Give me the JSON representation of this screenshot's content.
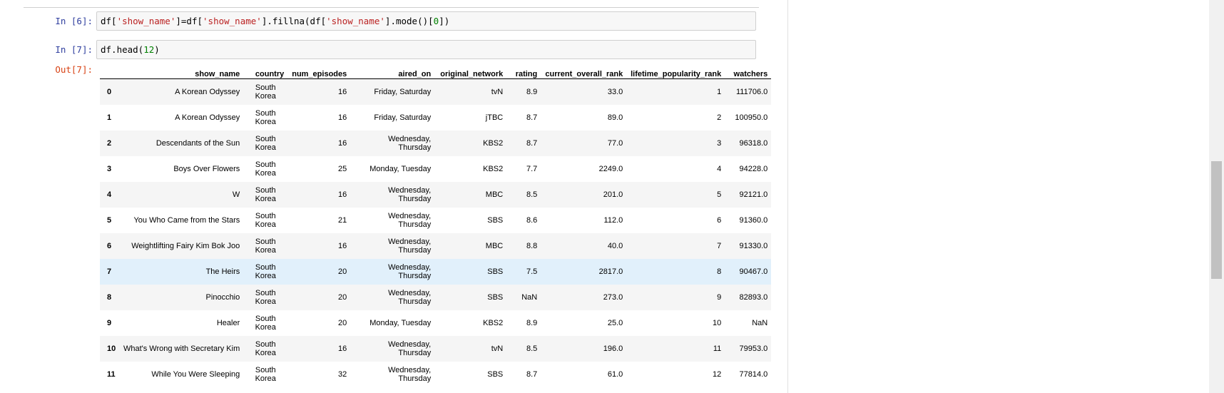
{
  "cells": [
    {
      "prompt": "In [6]:",
      "code": [
        {
          "t": "df[",
          "c": ""
        },
        {
          "t": "'show_name'",
          "c": "str"
        },
        {
          "t": "]=df[",
          "c": ""
        },
        {
          "t": "'show_name'",
          "c": "str"
        },
        {
          "t": "].fillna(df[",
          "c": ""
        },
        {
          "t": "'show_name'",
          "c": "str"
        },
        {
          "t": "].mode()[",
          "c": ""
        },
        {
          "t": "0",
          "c": "num"
        },
        {
          "t": "])",
          "c": ""
        }
      ]
    },
    {
      "prompt": "In [7]:",
      "code": [
        {
          "t": "df.head(",
          "c": ""
        },
        {
          "t": "12",
          "c": "num"
        },
        {
          "t": ")",
          "c": ""
        }
      ]
    }
  ],
  "output": {
    "prompt": "Out[7]:",
    "columns": [
      "",
      "show_name",
      "country",
      "num_episodes",
      "aired_on",
      "original_network",
      "rating",
      "current_overall_rank",
      "lifetime_popularity_rank",
      "watchers"
    ],
    "rows": [
      [
        "0",
        "A Korean Odyssey",
        "South Korea",
        "16",
        "Friday, Saturday",
        "tvN",
        "8.9",
        "33.0",
        "1",
        "111706.0"
      ],
      [
        "1",
        "A Korean Odyssey",
        "South Korea",
        "16",
        "Friday, Saturday",
        "jTBC",
        "8.7",
        "89.0",
        "2",
        "100950.0"
      ],
      [
        "2",
        "Descendants of the Sun",
        "South Korea",
        "16",
        "Wednesday, Thursday",
        "KBS2",
        "8.7",
        "77.0",
        "3",
        "96318.0"
      ],
      [
        "3",
        "Boys Over Flowers",
        "South Korea",
        "25",
        "Monday, Tuesday",
        "KBS2",
        "7.7",
        "2249.0",
        "4",
        "94228.0"
      ],
      [
        "4",
        "W",
        "South Korea",
        "16",
        "Wednesday, Thursday",
        "MBC",
        "8.5",
        "201.0",
        "5",
        "92121.0"
      ],
      [
        "5",
        "You Who Came from the Stars",
        "South Korea",
        "21",
        "Wednesday, Thursday",
        "SBS",
        "8.6",
        "112.0",
        "6",
        "91360.0"
      ],
      [
        "6",
        "Weightlifting Fairy Kim Bok Joo",
        "South Korea",
        "16",
        "Wednesday, Thursday",
        "MBC",
        "8.8",
        "40.0",
        "7",
        "91330.0"
      ],
      [
        "7",
        "The Heirs",
        "South Korea",
        "20",
        "Wednesday, Thursday",
        "SBS",
        "7.5",
        "2817.0",
        "8",
        "90467.0"
      ],
      [
        "8",
        "Pinocchio",
        "South Korea",
        "20",
        "Wednesday, Thursday",
        "SBS",
        "NaN",
        "273.0",
        "9",
        "82893.0"
      ],
      [
        "9",
        "Healer",
        "South Korea",
        "20",
        "Monday, Tuesday",
        "KBS2",
        "8.9",
        "25.0",
        "10",
        "NaN"
      ],
      [
        "10",
        "What's Wrong with Secretary Kim",
        "South Korea",
        "16",
        "Wednesday, Thursday",
        "tvN",
        "8.5",
        "196.0",
        "11",
        "79953.0"
      ],
      [
        "11",
        "While You Were Sleeping",
        "South Korea",
        "32",
        "Wednesday, Thursday",
        "SBS",
        "8.7",
        "61.0",
        "12",
        "77814.0"
      ]
    ],
    "highlighted_row": 7
  },
  "colors": {
    "in_prompt": "#303f9f",
    "out_prompt": "#d84315",
    "string": "#ba2121",
    "number": "#008000",
    "row_highlight": "#e1f0fb"
  }
}
